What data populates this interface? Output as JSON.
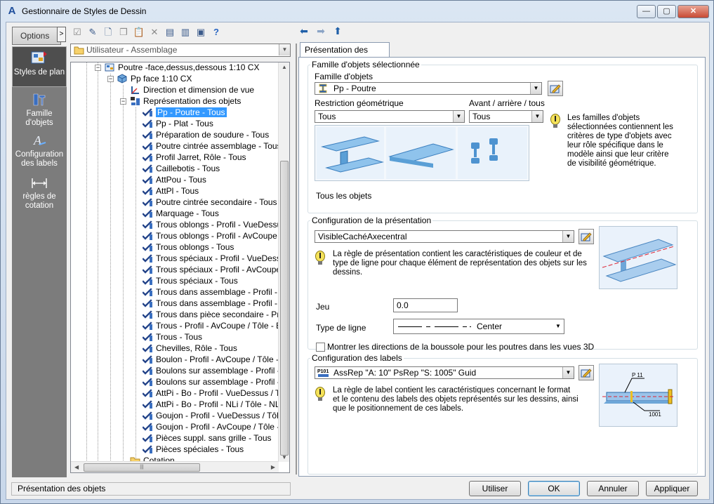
{
  "window": {
    "title": "Gestionnaire de Styles de Dessin",
    "app_icon": "A"
  },
  "window_buttons": {
    "minimize": "—",
    "maximize": "▢",
    "close": "✕"
  },
  "sidebar": {
    "options_label": "Options",
    "options_arrow": ">",
    "items": [
      {
        "label": "Styles de plan",
        "icon": "plan-styles-icon",
        "active": true
      },
      {
        "label": "Famille d'objets",
        "icon": "object-family-icon",
        "active": false
      },
      {
        "label": "Configuration des labels",
        "icon": "label-config-icon",
        "active": false
      },
      {
        "label": "règles de cotation",
        "icon": "dimension-rules-icon",
        "active": false
      }
    ]
  },
  "toolbar": {
    "icons": [
      "checkbox-icon",
      "edit-icon",
      "new-icon",
      "copy-icon",
      "paste-icon",
      "delete-icon",
      "import-icon",
      "export-icon",
      "save-icon",
      "help-icon"
    ],
    "nav": {
      "back": "⬅",
      "forward": "➡",
      "up": "⬆"
    }
  },
  "category_combo": {
    "value": "Utilisateur - Assemblage"
  },
  "tree": {
    "rows": [
      {
        "label": "Poutre -face,dessus,dessous 1:10 CX",
        "level": 0,
        "icon": "drawing-style-icon"
      },
      {
        "label": "Pp face 1:10 CX",
        "level": 1,
        "icon": "view-icon"
      },
      {
        "label": "Direction et dimension de vue",
        "level": 2,
        "icon": "direction-icon"
      },
      {
        "label": "Représentation des objets",
        "level": 2,
        "icon": "representation-icon"
      },
      {
        "label": "Pp - Poutre - Tous",
        "level": 3,
        "icon": "rule-icon",
        "selected": true
      },
      {
        "label": "Pp - Plat - Tous",
        "level": 3,
        "icon": "rule-icon"
      },
      {
        "label": "Préparation de soudure - Tous",
        "level": 3,
        "icon": "rule-icon"
      },
      {
        "label": "Poutre cintrée assemblage - Tous",
        "level": 3,
        "icon": "rule-icon"
      },
      {
        "label": "Profil Jarret, Rôle - Tous",
        "level": 3,
        "icon": "rule-icon"
      },
      {
        "label": "Caillebotis - Tous",
        "level": 3,
        "icon": "rule-icon"
      },
      {
        "label": "AttPou - Tous",
        "level": 3,
        "icon": "rule-icon"
      },
      {
        "label": "AttPl - Tous",
        "level": 3,
        "icon": "rule-icon"
      },
      {
        "label": "Poutre cintrée secondaire - Tous",
        "level": 3,
        "icon": "rule-icon"
      },
      {
        "label": "Marquage - Tous",
        "level": 3,
        "icon": "rule-icon"
      },
      {
        "label": "Trous oblongs - Profil - VueDessus",
        "level": 3,
        "icon": "rule-icon"
      },
      {
        "label": "Trous oblongs - Profil - AvCoupe /",
        "level": 3,
        "icon": "rule-icon"
      },
      {
        "label": "Trous oblongs - Tous",
        "level": 3,
        "icon": "rule-icon"
      },
      {
        "label": "Trous spéciaux - Profil - VueDessu",
        "level": 3,
        "icon": "rule-icon"
      },
      {
        "label": "Trous spéciaux - Profil - AvCoupe",
        "level": 3,
        "icon": "rule-icon"
      },
      {
        "label": "Trous spéciaux - Tous",
        "level": 3,
        "icon": "rule-icon"
      },
      {
        "label": "Trous dans assemblage - Profil - V",
        "level": 3,
        "icon": "rule-icon"
      },
      {
        "label": "Trous dans assemblage - Profil - A",
        "level": 3,
        "icon": "rule-icon"
      },
      {
        "label": "Trous dans pièce secondaire - Pro",
        "level": 3,
        "icon": "rule-icon"
      },
      {
        "label": "Trous - Profil - AvCoupe / Tôle - E",
        "level": 3,
        "icon": "rule-icon"
      },
      {
        "label": "Trous - Tous",
        "level": 3,
        "icon": "rule-icon"
      },
      {
        "label": "Chevilles, Rôle - Tous",
        "level": 3,
        "icon": "rule-icon"
      },
      {
        "label": "Boulon - Profil - AvCoupe / Tôle -",
        "level": 3,
        "icon": "rule-icon"
      },
      {
        "label": "Boulons sur assemblage - Profil - V",
        "level": 3,
        "icon": "rule-icon"
      },
      {
        "label": "Boulons sur assemblage - Profil - N",
        "level": 3,
        "icon": "rule-icon"
      },
      {
        "label": "AttPi - Bo - Profil - VueDessus / Tô",
        "level": 3,
        "icon": "rule-icon"
      },
      {
        "label": "AttPi - Bo - Profil - NLi / Tôle - NLi",
        "level": 3,
        "icon": "rule-icon"
      },
      {
        "label": "Goujon - Profil - VueDessus / Tôle",
        "level": 3,
        "icon": "rule-icon"
      },
      {
        "label": "Goujon - Profil - AvCoupe / Tôle -",
        "level": 3,
        "icon": "rule-icon"
      },
      {
        "label": "Pièces suppl. sans grille - Tous",
        "level": 3,
        "icon": "rule-icon"
      },
      {
        "label": "Pièces spéciales - Tous",
        "level": 3,
        "icon": "rule-icon"
      },
      {
        "label": "Cotation",
        "level": 2,
        "icon": "folder-icon"
      }
    ]
  },
  "tab": {
    "label": "Présentation des objets"
  },
  "selected_family": {
    "group_label": "Famille d'objets sélectionnée",
    "family_label": "Famille d'objets",
    "family_value": "Pp - Poutre",
    "geom_label": "Restriction géométrique",
    "geom_value": "Tous",
    "side_label": "Avant / arrière / tous",
    "side_value": "Tous",
    "images_caption": "Tous les objets",
    "note": "Les familles d'objets sélectionnées contiennent les critères de type d'objets avec leur rôle spécifique dans le modèle ainsi que leur critère de visibilité géométrique."
  },
  "presentation": {
    "group_label": "Configuration de la présentation",
    "value": "VisibleCachéAxecentral",
    "note": "La règle de présentation contient les caractéristiques de couleur et de type de ligne pour chaque élément de représentation des objets sur les dessins.",
    "gap_label": "Jeu",
    "gap_value": "0.0",
    "linetype_label": "Type de ligne",
    "linetype_value": "Center",
    "checkbox_label": "Montrer les directions de la boussole pour les poutres dans les vues 3D",
    "checkbox_checked": false
  },
  "labels_config": {
    "group_label": "Configuration des labels",
    "value": "AssRep \"A: 10\" PsRep \"S: 1005\" Guid",
    "note": "La règle de label contient les caractéristiques concernant le format et le contenu des labels des objets représentés sur les dessins, ainsi que le positionnement de ces labels.",
    "preview_label_top": "P 11",
    "preview_label_bottom": "1001"
  },
  "status_bar": {
    "text": "Présentation des objets"
  },
  "buttons": {
    "use": "Utiliser",
    "ok": "OK",
    "cancel": "Annuler",
    "apply": "Appliquer"
  },
  "colors": {
    "selection": "#3399ff",
    "sidebar_bg": "#7c7c7c",
    "accent_blue": "#1f5fa8"
  }
}
